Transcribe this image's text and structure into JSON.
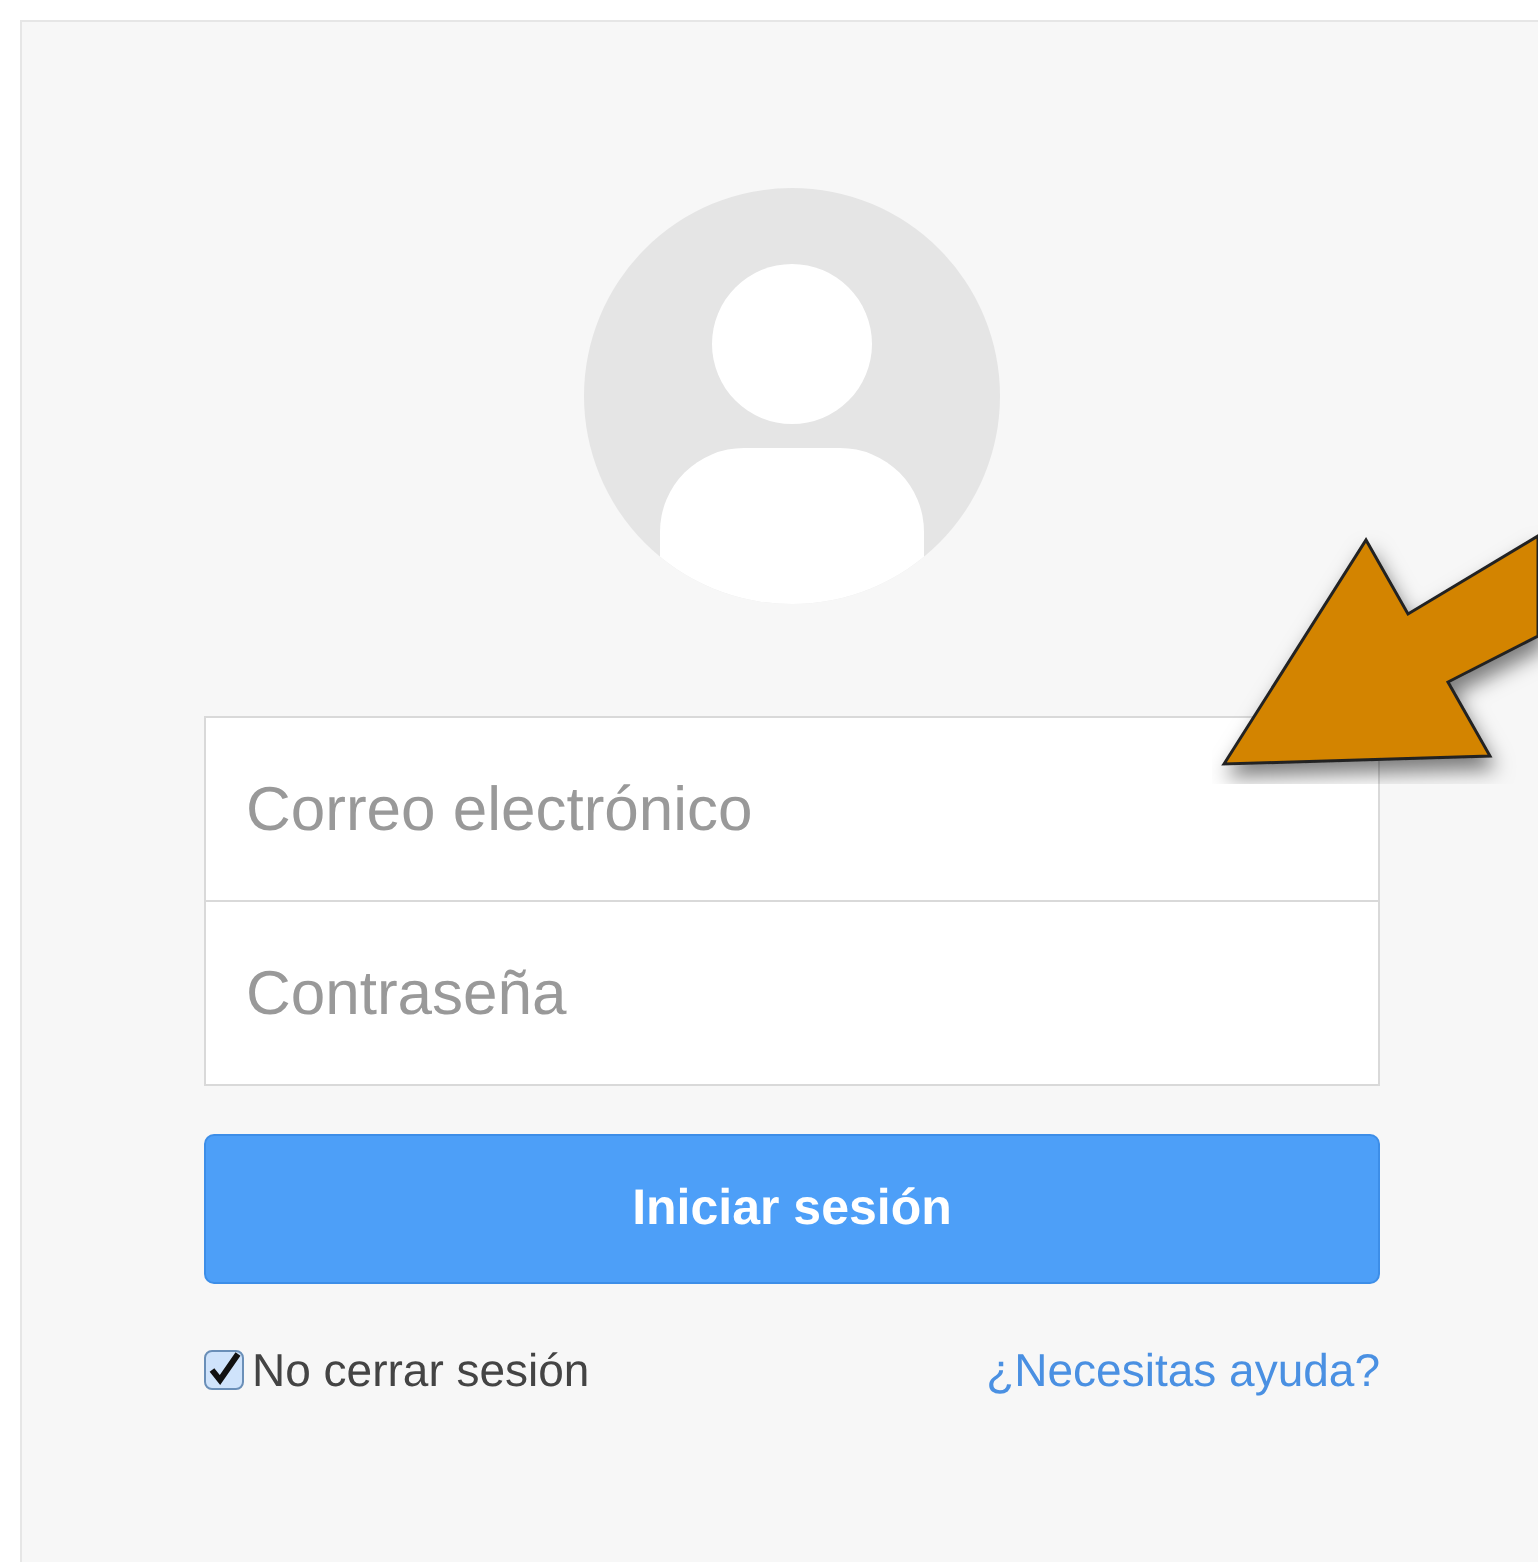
{
  "login": {
    "email": {
      "placeholder": "Correo electrónico"
    },
    "password": {
      "placeholder": "Contraseña"
    },
    "submit": "Iniciar sesión",
    "remember": {
      "label": "No cerrar sesión",
      "checked": true
    },
    "help_link": "¿Necesitas ayuda?"
  }
}
